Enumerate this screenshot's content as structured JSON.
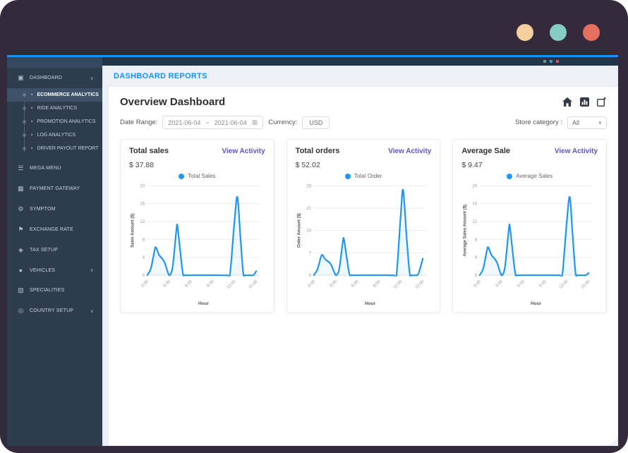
{
  "frame": {
    "dots": [
      {
        "name": "window-dot-1",
        "color": "#f6cf9e"
      },
      {
        "name": "window-dot-2",
        "color": "#85ccc2"
      },
      {
        "name": "window-dot-3",
        "color": "#e6705e"
      }
    ],
    "topbar_status_colors": [
      "#7d8fa3",
      "#4a90d9",
      "#d9534f"
    ]
  },
  "header": {
    "breadcrumb": "DASHBOARD REPORTS"
  },
  "icons": {
    "chevron_down": "∨",
    "calendar": "▦"
  },
  "sidebar": {
    "items": [
      {
        "label": "DASHBOARD",
        "icon": "▣",
        "chevron": true,
        "children": [
          {
            "label": "ECOMMERCE ANALYTICS",
            "icon": "▪",
            "active": true
          },
          {
            "label": "RIDE ANALYTICS",
            "icon": "▪",
            "active": false
          },
          {
            "label": "PROMOTION ANALYTICS",
            "icon": "▪",
            "active": false
          },
          {
            "label": "LOG ANALYTICS",
            "icon": "▪",
            "active": false
          },
          {
            "label": "DRIVER PAYOUT REPORT",
            "icon": "▪",
            "active": false
          }
        ]
      },
      {
        "label": "MEGA MENU",
        "icon": "☰",
        "chevron": false
      },
      {
        "label": "PAYMENT GATEWAY",
        "icon": "▦",
        "chevron": false
      },
      {
        "label": "SYMPTOM",
        "icon": "⚙",
        "chevron": false
      },
      {
        "label": "EXCHANGE RATE",
        "icon": "⚑",
        "chevron": false
      },
      {
        "label": "TAX SETUP",
        "icon": "◈",
        "chevron": false
      },
      {
        "label": "VEHICLES",
        "icon": "●",
        "chevron": true
      },
      {
        "label": "SPECIALITIES",
        "icon": "▨",
        "chevron": false
      },
      {
        "label": "COUNTRY SETUP",
        "icon": "◎",
        "chevron": true
      }
    ]
  },
  "overview": {
    "title": "Overview Dashboard",
    "date_range_label": "Date Range:",
    "date_from": "2021-06-04",
    "date_separator": "~",
    "date_to": "2021-06-04",
    "currency_label": "Currency:",
    "currency_value": "USD",
    "store_category_label": "Store category :",
    "store_category_value": "All"
  },
  "cards": [
    {
      "title": "Total sales",
      "link_label": "View Activity",
      "amount": "$ 37.88",
      "legend": "Total Sales"
    },
    {
      "title": "Total orders",
      "link_label": "View Activity",
      "amount": "$ 52.02",
      "legend": "Total Order"
    },
    {
      "title": "Average Sale",
      "link_label": "View Activity",
      "amount": "$ 9.47",
      "legend": "Average Sales"
    }
  ],
  "chart_data": [
    {
      "type": "line",
      "title": "Total Sales",
      "xlabel": "Hour",
      "ylabel": "Sales Amount ($)",
      "color": "#2196f3",
      "grid": true,
      "legend_position": "top",
      "xlim": [
        0,
        15.5
      ],
      "ylim": [
        0,
        20
      ],
      "yticks": [
        0,
        4,
        8,
        12,
        16,
        20
      ],
      "xtick_values": [
        0,
        3,
        6,
        9,
        12,
        15
      ],
      "xtick_labels": [
        "0:00",
        "3:00",
        "6:00",
        "9:00",
        "12:00",
        "15:00"
      ],
      "points": [
        [
          0,
          0
        ],
        [
          0.5,
          1.5
        ],
        [
          1,
          5.5
        ],
        [
          1.2,
          6.2
        ],
        [
          1.6,
          4.6
        ],
        [
          2.1,
          3.6
        ],
        [
          2.4,
          2.8
        ],
        [
          2.8,
          0.8
        ],
        [
          3.1,
          0
        ],
        [
          3.5,
          2
        ],
        [
          4,
          10
        ],
        [
          4.15,
          11
        ],
        [
          4.5,
          6
        ],
        [
          4.9,
          0.4
        ],
        [
          5.2,
          0
        ],
        [
          6,
          0
        ],
        [
          7,
          0
        ],
        [
          8,
          0
        ],
        [
          9,
          0
        ],
        [
          10,
          0
        ],
        [
          11,
          0
        ],
        [
          11.4,
          0.5
        ],
        [
          12,
          12
        ],
        [
          12.4,
          17.5
        ],
        [
          12.8,
          9
        ],
        [
          13.2,
          0.5
        ],
        [
          13.5,
          0
        ],
        [
          14,
          0
        ],
        [
          14.6,
          0
        ],
        [
          15,
          0.9
        ]
      ]
    },
    {
      "type": "line",
      "title": "Total Order",
      "xlabel": "Hour",
      "ylabel": "Order Amount ($)",
      "color": "#2196f3",
      "grid": true,
      "legend_position": "top",
      "xlim": [
        0,
        15.5
      ],
      "ylim": [
        0,
        28
      ],
      "yticks": [
        0,
        7,
        14,
        21,
        28
      ],
      "xtick_values": [
        0,
        3,
        6,
        9,
        12,
        15
      ],
      "xtick_labels": [
        "0:00",
        "3:00",
        "6:00",
        "9:00",
        "12:00",
        "15:00"
      ],
      "points": [
        [
          0,
          0
        ],
        [
          0.5,
          1.8
        ],
        [
          1,
          5.8
        ],
        [
          1.2,
          6.3
        ],
        [
          1.6,
          4.9
        ],
        [
          2.1,
          4.1
        ],
        [
          2.4,
          3.2
        ],
        [
          2.8,
          1
        ],
        [
          3.1,
          0
        ],
        [
          3.5,
          2
        ],
        [
          4,
          10.5
        ],
        [
          4.15,
          11.2
        ],
        [
          4.5,
          6
        ],
        [
          4.9,
          0.4
        ],
        [
          5.2,
          0
        ],
        [
          6,
          0
        ],
        [
          7,
          0
        ],
        [
          8,
          0
        ],
        [
          9,
          0
        ],
        [
          10,
          0
        ],
        [
          11,
          0
        ],
        [
          11.4,
          0.6
        ],
        [
          12,
          20
        ],
        [
          12.3,
          26.5
        ],
        [
          12.8,
          11
        ],
        [
          13.2,
          0.5
        ],
        [
          13.5,
          0
        ],
        [
          14,
          0
        ],
        [
          14.4,
          0.5
        ],
        [
          15,
          5.2
        ]
      ]
    },
    {
      "type": "line",
      "title": "Average Sales",
      "xlabel": "Hour",
      "ylabel": "Average Sales Amount ($)",
      "color": "#2196f3",
      "grid": true,
      "legend_position": "top",
      "xlim": [
        0,
        15.5
      ],
      "ylim": [
        0,
        20
      ],
      "yticks": [
        0,
        4,
        8,
        12,
        16,
        20
      ],
      "xtick_values": [
        0,
        3,
        6,
        9,
        12,
        15
      ],
      "xtick_labels": [
        "0:00",
        "3:00",
        "6:00",
        "9:00",
        "12:00",
        "15:00"
      ],
      "points": [
        [
          0,
          0
        ],
        [
          0.5,
          1.5
        ],
        [
          1,
          5.5
        ],
        [
          1.2,
          6.2
        ],
        [
          1.6,
          4.6
        ],
        [
          2.1,
          3.6
        ],
        [
          2.4,
          2.8
        ],
        [
          2.8,
          0.8
        ],
        [
          3.1,
          0
        ],
        [
          3.5,
          2
        ],
        [
          4,
          10
        ],
        [
          4.15,
          11
        ],
        [
          4.5,
          6
        ],
        [
          4.9,
          0.4
        ],
        [
          5.2,
          0
        ],
        [
          6,
          0
        ],
        [
          7,
          0
        ],
        [
          8,
          0
        ],
        [
          9,
          0
        ],
        [
          10,
          0
        ],
        [
          11,
          0
        ],
        [
          11.4,
          0.4
        ],
        [
          12,
          12
        ],
        [
          12.4,
          17.5
        ],
        [
          12.8,
          9
        ],
        [
          13.2,
          0.5
        ],
        [
          13.5,
          0
        ],
        [
          14,
          0
        ],
        [
          14.6,
          0
        ],
        [
          15,
          0.5
        ]
      ]
    }
  ]
}
